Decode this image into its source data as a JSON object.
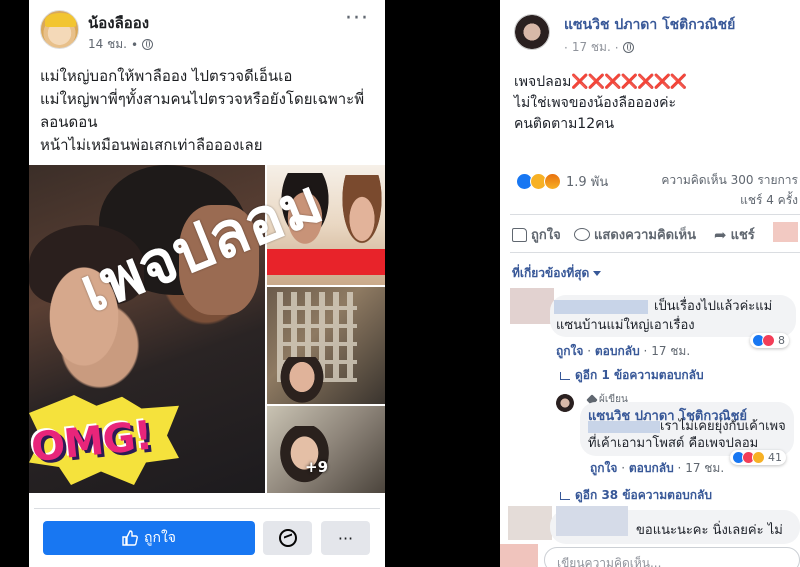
{
  "left_post": {
    "author": "น้องลืออง",
    "time": "14 ชม.",
    "more": "···",
    "text_lines": [
      "แม่ใหญ่บอกให้พาลืออง ไปตรวจดีเอ็นเอ",
      "แม่ใหญ่พาพี่ๆทั้งสามคนไปตรวจหรือยังโดยเฉพาะพี่",
      "ลอนดอน",
      "หน้าไม่เหมือนพ่อเสกเท่าลืออองเลย"
    ],
    "watermark": "เพจปลอม",
    "omg_sticker": "OMG!",
    "more_photos": "+9",
    "like_label": "ถูกใจ",
    "more_label": "···",
    "like_color": "#1877f2"
  },
  "right_post": {
    "author": "แซนวิช ปภาดา โชติกวณิชย์",
    "time": "17 ชม.",
    "text_line1_prefix": "เพจปลอม",
    "text_line1_marks": "❌❌❌❌❌❌❌",
    "text_line2": "ไม่ใช่เพจของน้องลืออองค่ะ",
    "text_line3": "คนติดตาม12คน",
    "reactions_count": "1.9 พัน",
    "comments_count": "ความคิดเห็น 300 รายการ",
    "shares_count": "แชร์ 4 ครั้ง",
    "action_like": "ถูกใจ",
    "action_comment": "แสดงความคิดเห็น",
    "action_share": "แชร์",
    "relevant_filter": "ที่เกี่ยวข้องที่สุด",
    "comment1": {
      "text1": "เป็นเรื่องไปแล้วค่ะแม่",
      "text2": "แซนบ้านแม่ใหญ่เอาเรื่อง",
      "like": "ถูกใจ",
      "reply": "ตอบกลับ",
      "time": "17 ชม.",
      "react_count": "8"
    },
    "comment1_more_replies": "ดูอีก 1 ข้อความตอบกลับ",
    "reply1": {
      "badge": "ผู้เขียน",
      "name": "แซนวิช ปภาดา โชติกวณิชย์",
      "text1": "เราไม่เคยยุ่งกับเค้าเพจ",
      "text2": "ที่เค้าเอามาโพสต์ คือเพจปลอม",
      "like": "ถูกใจ",
      "reply": "ตอบกลับ",
      "time": "17 ชม.",
      "react_count": "41"
    },
    "reply1_more_replies": "ดูอีก 38 ข้อความตอบกลับ",
    "comment2": {
      "text1": "ขอแนะนะคะ นิ่งเลยค่ะ ไม่"
    },
    "input_placeholder": "เขียนความคิดเห็น..."
  }
}
